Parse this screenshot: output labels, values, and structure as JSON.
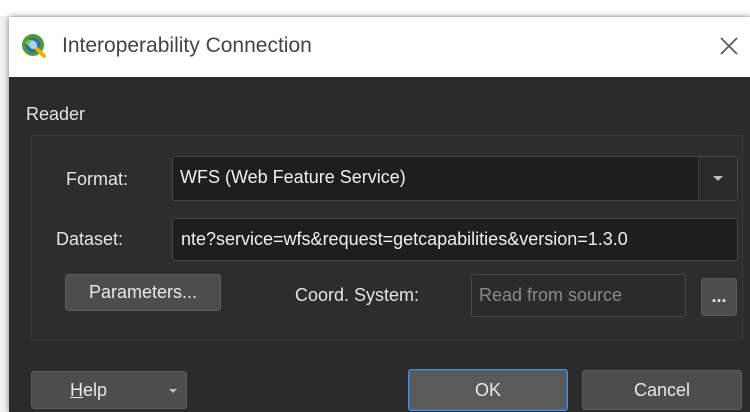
{
  "window": {
    "title": "Interoperability Connection",
    "app_icon": "qgis-logo-icon",
    "close_icon": "close-icon"
  },
  "reader": {
    "group_label": "Reader",
    "format_label": "Format:",
    "format_value": "WFS (Web Feature Service)",
    "format_dropdown_icon": "chevron-down-icon",
    "dataset_label": "Dataset:",
    "dataset_value": "nte?service=wfs&request=getcapabilities&version=1.3.0",
    "parameters_button": "Parameters...",
    "coord_system_label": "Coord. System:",
    "coord_system_placeholder": "Read from source",
    "browse_button": "..."
  },
  "footer": {
    "help_button": "Help",
    "help_mnemonic": "H",
    "help_rest": "elp",
    "ok_button": "OK",
    "cancel_button": "Cancel"
  },
  "colors": {
    "dialog_bg": "#2b2b2b",
    "titlebar_bg": "#ffffff",
    "ok_focus_border": "#4a8fd6"
  }
}
